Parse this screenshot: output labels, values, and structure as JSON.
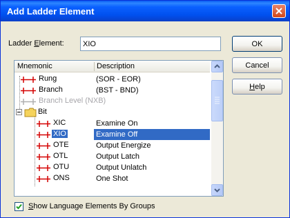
{
  "dialog": {
    "title": "Add Ladder Element",
    "ladder_element_label_pre": "Ladder ",
    "ladder_element_label_u": "E",
    "ladder_element_label_post": "lement:",
    "ladder_element_value": "XIO"
  },
  "buttons": {
    "ok": "OK",
    "cancel": "Cancel",
    "help_u": "H",
    "help_rest": "elp"
  },
  "list": {
    "columns": {
      "mnemonic": "Mnemonic",
      "description": "Description"
    },
    "items": [
      {
        "mnemonic": "Rung",
        "description": "(SOR - EOR)",
        "disabled": false,
        "selected": false
      },
      {
        "mnemonic": "Branch",
        "description": "(BST - BND)",
        "disabled": false,
        "selected": false
      },
      {
        "mnemonic": "Branch Level (NXB)",
        "description": "",
        "disabled": true,
        "selected": false
      },
      {
        "mnemonic": "Bit",
        "description": "",
        "disabled": false,
        "selected": false
      },
      {
        "mnemonic": "XIC",
        "description": "Examine On",
        "disabled": false,
        "selected": false
      },
      {
        "mnemonic": "XIO",
        "description": "Examine Off",
        "disabled": false,
        "selected": true
      },
      {
        "mnemonic": "OTE",
        "description": "Output Energize",
        "disabled": false,
        "selected": false
      },
      {
        "mnemonic": "OTL",
        "description": "Output Latch",
        "disabled": false,
        "selected": false
      },
      {
        "mnemonic": "OTU",
        "description": "Output Unlatch",
        "disabled": false,
        "selected": false
      },
      {
        "mnemonic": "ONS",
        "description": "One Shot",
        "disabled": false,
        "selected": false
      }
    ]
  },
  "checkbox": {
    "checked": true,
    "label_u": "S",
    "label_rest": "how Language Elements By Groups"
  },
  "colors": {
    "accent": "#316ac5",
    "rung_icon": "#d40000",
    "folder": "#f5d35c"
  }
}
